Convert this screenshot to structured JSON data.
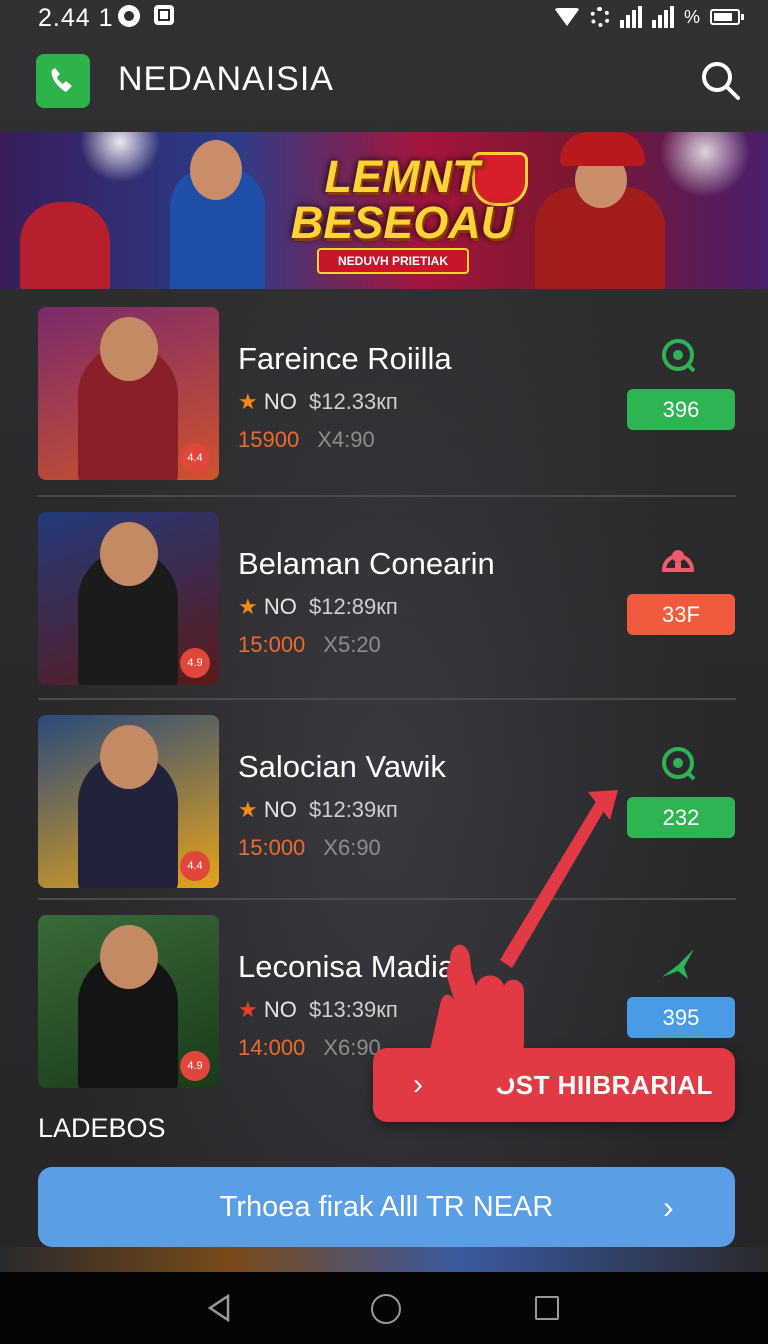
{
  "status_bar": {
    "time": "2.44 1",
    "battery_text": "%"
  },
  "app": {
    "title": "NEDANAISIA"
  },
  "banner": {
    "title_line1": "LEMNT",
    "title_line2": "BESEOAU",
    "tag": "NEDUVH PRIETIAK"
  },
  "items": [
    {
      "name": "Fareince Roiilla",
      "level": "NO",
      "price": "$12.33",
      "price_unit": "кп",
      "stat1": "15900",
      "stat2": "X4:90",
      "badge": "396",
      "badge_color": "#2fb453",
      "status_icon": "target-icon",
      "rating": "4.4",
      "thumb_colors": [
        "#7a2a6b",
        "#d0542a"
      ]
    },
    {
      "name": "Belaman Conearin",
      "level": "NO",
      "price": "$12:89",
      "price_unit": "кп",
      "stat1": "15:000",
      "stat2": "X5:20",
      "badge": "33F",
      "badge_color": "#ef5b3c",
      "status_icon": "user-lock-icon",
      "rating": "4.9",
      "thumb_colors": [
        "#243a7a",
        "#1b1b1b"
      ]
    },
    {
      "name": "Salocian Vawik",
      "level": "NO",
      "price": "$12:39",
      "price_unit": "кп",
      "stat1": "15:000",
      "stat2": "X6:90",
      "badge": "232",
      "badge_color": "#2fb453",
      "status_icon": "target-icon",
      "rating": "4.4",
      "thumb_colors": [
        "#2a4a7a",
        "#e6a31a"
      ]
    },
    {
      "name": "Leconisa Madiax",
      "level": "NO",
      "price": "$13:39",
      "price_unit": "кп",
      "stat1": "14:000",
      "stat2": "X6:90",
      "badge": "395",
      "badge_color": "#4a9be6",
      "status_icon": "plane-icon",
      "rating": "4.9",
      "thumb_colors": [
        "#2a5a2a",
        "#141414"
      ]
    }
  ],
  "cta": {
    "label": "OST HIIBRARIAL"
  },
  "section": {
    "title": "LADEBOS"
  },
  "wide_button": {
    "label": "Trhoea firak Alll TR NEAR"
  }
}
